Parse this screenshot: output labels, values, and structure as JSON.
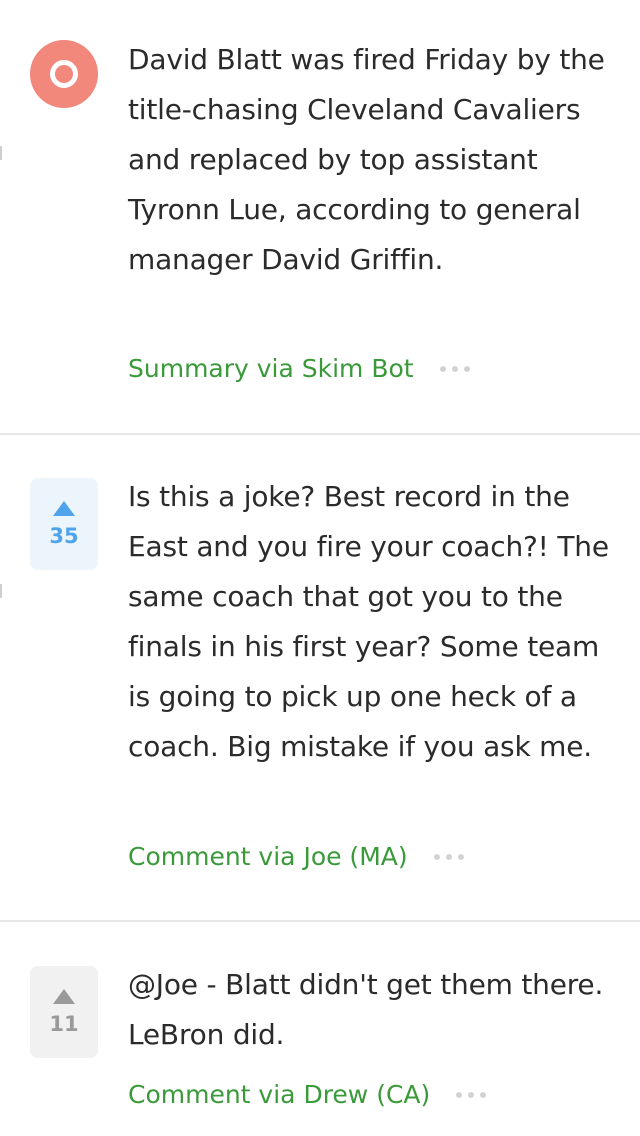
{
  "feed": {
    "items": [
      {
        "kind": "summary",
        "text": "David Blatt was fired Friday by the title-chasing Cleveland Cavaliers and replaced by top assistant Tyronn Lue, according to general manager David Griffin.",
        "meta": "Summary via Skim Bot",
        "icon": "skim-bot-logo",
        "icon_color": "#f2877b"
      },
      {
        "kind": "comment",
        "votes": "35",
        "upvoted": true,
        "text": "Is this a joke? Best record in the East and you fire your coach?! The same coach that got you to the finals in his first year? Some team is going to pick up one heck of a coach. Big mistake if you ask me.",
        "meta": "Comment via Joe (MA)"
      },
      {
        "kind": "comment",
        "votes": "11",
        "upvoted": false,
        "text": "@Joe - Blatt didn't get them there. LeBron did.",
        "meta": "Comment via Drew (CA)"
      }
    ]
  },
  "colors": {
    "meta_green": "#3a9a3a",
    "upvote_blue": "#4fa3ea",
    "neutral_gray": "#9a9a9a",
    "logo_salmon": "#f2877b"
  }
}
